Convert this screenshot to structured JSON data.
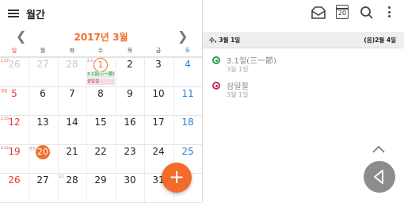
{
  "app": {
    "title": "월간",
    "month_title": "2017년 3월"
  },
  "weekdays": [
    "일",
    "월",
    "화",
    "수",
    "목",
    "금",
    "토"
  ],
  "calendar": {
    "weeks": [
      [
        {
          "day": "26",
          "muted": true,
          "lunar": "1.27"
        },
        {
          "day": "27",
          "muted": true
        },
        {
          "day": "28",
          "muted": true
        },
        {
          "day": "1",
          "lunar": "2.4",
          "outline": true,
          "events": [
            "3.1절(三一節)",
            "삼일절"
          ]
        },
        {
          "day": "2"
        },
        {
          "day": "3"
        },
        {
          "day": "4"
        }
      ],
      [
        {
          "day": "5",
          "lunar": "경칩"
        },
        {
          "day": "6"
        },
        {
          "day": "7"
        },
        {
          "day": "8"
        },
        {
          "day": "9"
        },
        {
          "day": "10"
        },
        {
          "day": "11"
        }
      ],
      [
        {
          "day": "12",
          "lunar": "2.15"
        },
        {
          "day": "13"
        },
        {
          "day": "14"
        },
        {
          "day": "15"
        },
        {
          "day": "16"
        },
        {
          "day": "17"
        },
        {
          "day": "18"
        }
      ],
      [
        {
          "day": "19",
          "lunar": "2.22"
        },
        {
          "day": "20",
          "lunar": "춘분",
          "today": true
        },
        {
          "day": "21"
        },
        {
          "day": "22"
        },
        {
          "day": "23"
        },
        {
          "day": "24"
        },
        {
          "day": "25"
        }
      ],
      [
        {
          "day": "26"
        },
        {
          "day": "27"
        },
        {
          "day": "28",
          "lunar": "3.1"
        },
        {
          "day": "29"
        },
        {
          "day": "30"
        },
        {
          "day": "31"
        },
        {
          "day": ""
        }
      ]
    ]
  },
  "fab": {
    "label": "+"
  },
  "toolbar": {
    "today_badge": "20"
  },
  "day_panel": {
    "date_label": "수, 3월 1일",
    "lunar_label": "(음)2월 4일",
    "events": [
      {
        "title": "3.1절(三一節)",
        "date": "3월 1일",
        "color": "green"
      },
      {
        "title": "삼일절",
        "date": "3월 1일",
        "color": "pink"
      }
    ]
  },
  "colors": {
    "accent": "#f0712c",
    "sunday": "#e33333",
    "saturday": "#2a7ed6",
    "event_green": "#2e9a4c",
    "event_pink": "#b9355b"
  }
}
